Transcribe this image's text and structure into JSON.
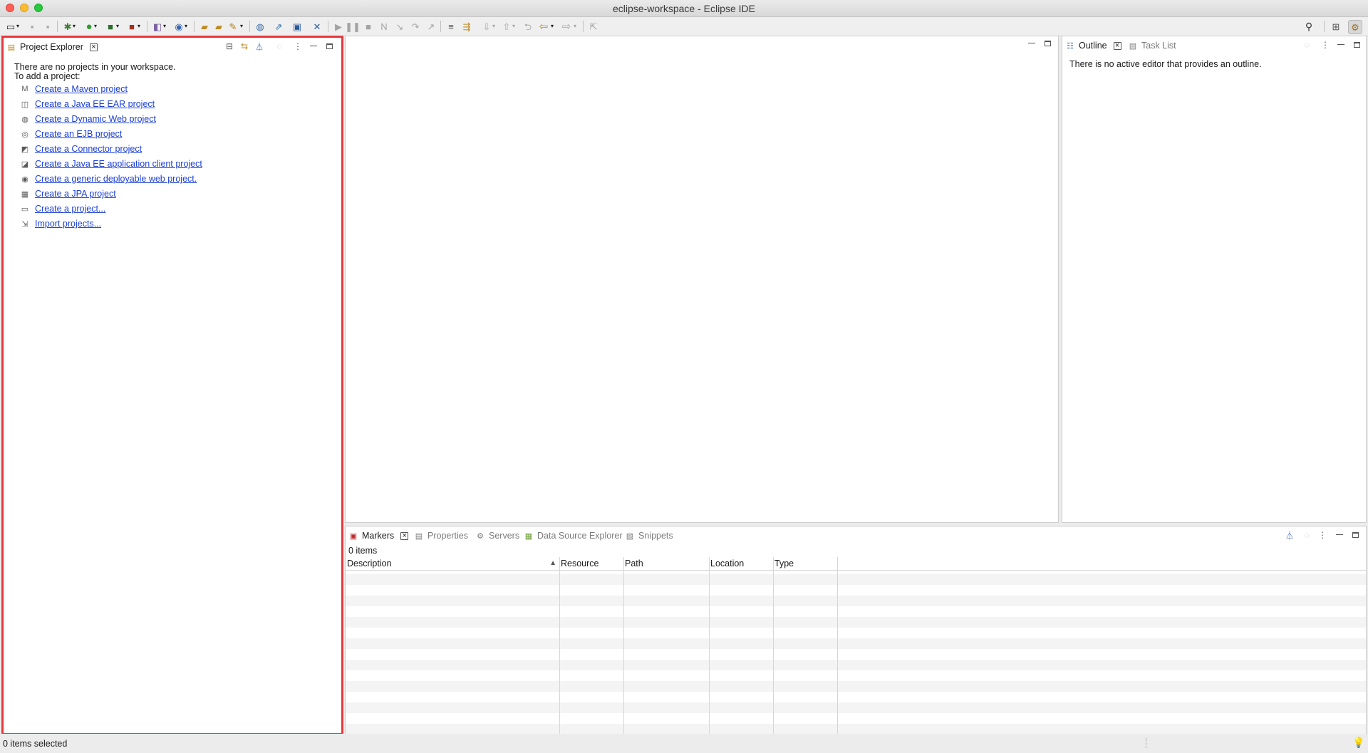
{
  "window": {
    "title": "eclipse-workspace - Eclipse IDE"
  },
  "project_explorer": {
    "tab_label": "Project Explorer",
    "empty_line1": "There are no projects in your workspace.",
    "empty_line2": "To add a project:",
    "links": [
      {
        "label": "Create a Maven project",
        "icon": "maven-icon"
      },
      {
        "label": "Create a Java EE EAR project",
        "icon": "ear-project-icon"
      },
      {
        "label": "Create a Dynamic Web project",
        "icon": "web-project-icon"
      },
      {
        "label": "Create an EJB project",
        "icon": "ejb-project-icon"
      },
      {
        "label": "Create a Connector project",
        "icon": "connector-project-icon"
      },
      {
        "label": "Create a Java EE application client project",
        "icon": "app-client-project-icon"
      },
      {
        "label": "Create a generic deployable web project.",
        "icon": "generic-web-project-icon"
      },
      {
        "label": "Create a JPA project",
        "icon": "jpa-project-icon"
      },
      {
        "label": "Create a project...",
        "icon": "new-project-icon"
      },
      {
        "label": "Import projects...",
        "icon": "import-icon"
      }
    ]
  },
  "outline": {
    "tab_label": "Outline",
    "tab2_label": "Task List",
    "message": "There is no active editor that provides an outline."
  },
  "bottom": {
    "tabs": [
      "Markers",
      "Properties",
      "Servers",
      "Data Source Explorer",
      "Snippets"
    ],
    "count": "0 items",
    "columns": [
      "Description",
      "Resource",
      "Path",
      "Location",
      "Type"
    ]
  },
  "status": {
    "text": "0 items selected"
  },
  "colors": {
    "highlight": "#e8383d",
    "link": "#1a3fd6"
  }
}
